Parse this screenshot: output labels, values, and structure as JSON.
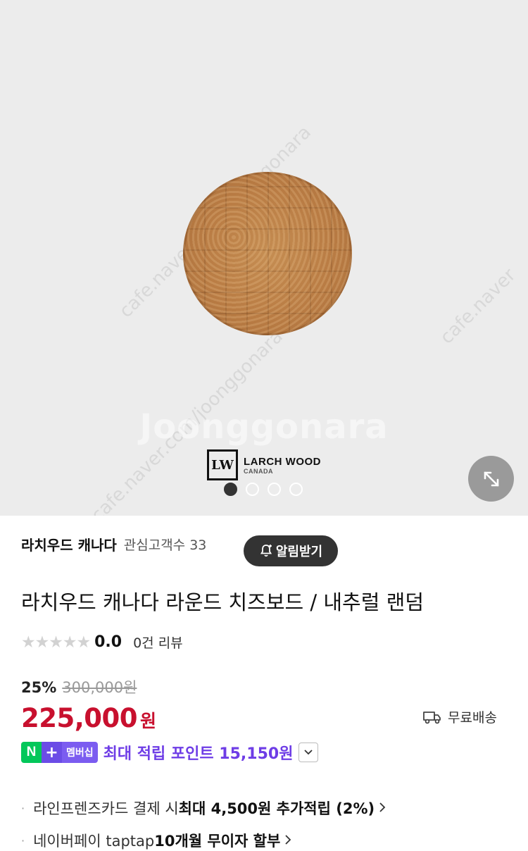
{
  "gallery": {
    "watermark": "Joonggonara",
    "watermark_diag_1": "cafe.naver.com/joonggonara",
    "watermark_diag_2": "cafe.naver.com/joonggonara",
    "watermark_diag_3": "cafe.naver",
    "logo_mark": "LW",
    "logo_line1": "LARCH WOOD",
    "logo_line2": "CANADA",
    "slide_count": 4,
    "active_slide": 1,
    "expand_icon": "expand-icon"
  },
  "store": {
    "name": "라치우드 캐나다",
    "followers": "관심고객수 33",
    "alert_label": "알림받기",
    "alert_icon": "bell-plus-icon"
  },
  "product": {
    "title": "라치우드 캐나다 라운드 치즈보드 / 내추럴 랜덤",
    "stars": "★★★★★",
    "rating": "0.0",
    "review_count": "0건 리뷰",
    "discount": "25%",
    "original_price": "300,000원",
    "price": "225,000",
    "price_unit": "원",
    "shipping": "무료배송",
    "shipping_icon": "truck-icon"
  },
  "points": {
    "badge_n": "N",
    "badge_plus": "+",
    "badge_member": "멤버십",
    "text": "최대 적립 포인트 15,150원",
    "colors": {
      "n": "#03c75a",
      "plus": "#6b4ce6",
      "text": "#6e3de6"
    }
  },
  "benefits": [
    {
      "prefix": "라인프렌즈카드 결제 시 ",
      "bold": "최대 4,500원 추가적립 (2%)"
    },
    {
      "prefix": "네이버페이 taptap ",
      "bold": "10개월 무이자 할부"
    }
  ],
  "colors": {
    "price": "#c8102e",
    "gallery_bg": "#ececec"
  }
}
